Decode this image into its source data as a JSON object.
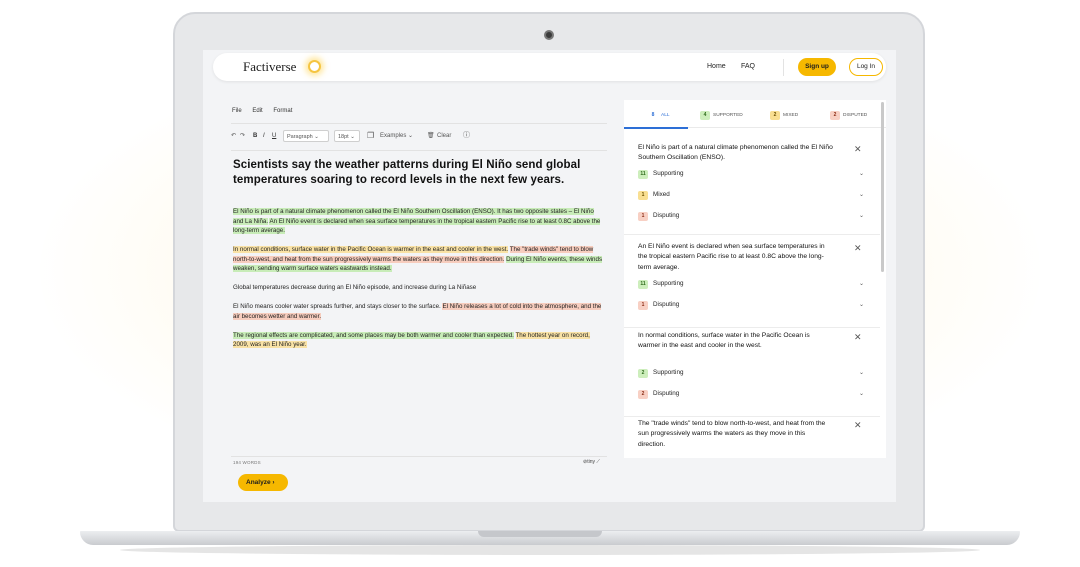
{
  "nav": {
    "logo": "Factiverse",
    "links": [
      "Home",
      "FAQ"
    ],
    "signup": "Sign up",
    "login": "Log In"
  },
  "editor": {
    "menu": [
      "File",
      "Edit",
      "Format"
    ],
    "toolbar": {
      "paragraph": "Paragraph",
      "font_size": "18pt",
      "examples": "Examples",
      "clear": "Clear"
    },
    "headline": "Scientists say the weather patterns during El Niño send global temperatures soaring to record levels in the next few years.",
    "p1_a": "El Niño is part of a natural climate phenomenon called the El Niño Southern Oscillation (ENSO). It has two opposite states – El Niño and La Niña.",
    "p1_b": "An El Niño event is declared when sea surface temperatures in the tropical eastern Pacific rise to at least 0.8C above the long-term average.",
    "p2_a": "In normal conditions, surface water in the Pacific Ocean is warmer in the east and cooler in the west.",
    "p2_b": "The \"trade winds\" tend to blow north-to-west, and heat from the sun progressively warms the waters as they move in this direction.",
    "p2_c": "During El Niño events, these winds weaken, sending warm surface waters eastwards instead.",
    "p3": "Global temperatures decrease during an El Niño episode, and increase during La Niñase",
    "p4_a": "El Niño means cooler water spreads further, and stays closer to the surface.",
    "p4_b": "El Niño releases a lot of cold into the atmosphere, and the air becomes wetter and warmer.",
    "p5_a": "The regional effects are complicated, and some places may be both warmer and cooler than expected.",
    "p5_b": "The hottest year on record, 2009, was an El Niño year.",
    "word_count": "194 WORDS",
    "tiny": "tiny",
    "analyze": "Analyze"
  },
  "panel": {
    "tabs": [
      {
        "count": "8",
        "label": "ALL"
      },
      {
        "count": "4",
        "label": "SUPPORTED"
      },
      {
        "count": "2",
        "label": "MIXED"
      },
      {
        "count": "2",
        "label": "DISPUTED"
      }
    ],
    "claims": [
      {
        "text": "El Niño is part of a natural climate phenomenon called the El Niño Southern Oscillation (ENSO).",
        "evidence": [
          {
            "count": "11",
            "label": "Supporting"
          },
          {
            "count": "1",
            "label": "Mixed"
          },
          {
            "count": "1",
            "label": "Disputing"
          }
        ]
      },
      {
        "text": "An El Niño event is declared when sea surface temperatures in the tropical eastern Pacific rise to at least 0.8C above the long-term average.",
        "evidence": [
          {
            "count": "11",
            "label": "Supporting"
          },
          {
            "count": "1",
            "label": "Disputing"
          }
        ]
      },
      {
        "text": "In normal conditions, surface water in the Pacific Ocean is warmer in the east and cooler in the west.",
        "evidence": [
          {
            "count": "2",
            "label": "Supporting"
          },
          {
            "count": "2",
            "label": "Disputing"
          }
        ]
      },
      {
        "text": "The \"trade winds\" tend to blow north-to-west, and heat from the sun progressively warms the waters as they move in this direction.",
        "evidence": []
      }
    ]
  },
  "colors": {
    "accent": "#f6b800",
    "supported": "#c8ecb8",
    "mixed": "#f9e2a6",
    "disputed": "#f7cdbe",
    "tab_active": "#2d6fd6"
  }
}
